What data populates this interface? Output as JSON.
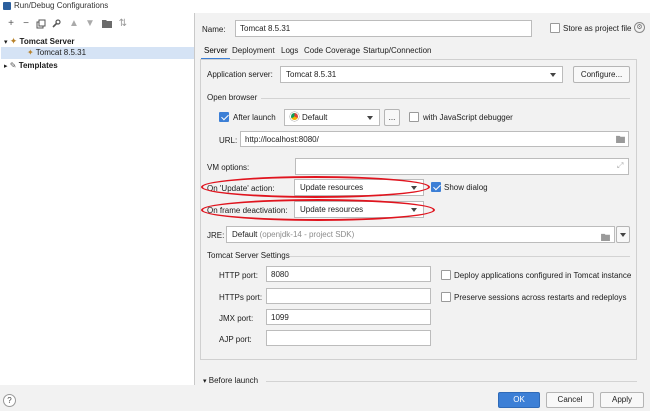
{
  "window": {
    "title": "Run/Debug Configurations"
  },
  "toolbar": {
    "icons": [
      "plus-icon",
      "minus-icon",
      "copy-icon",
      "wrench-icon",
      "arrow-up-icon",
      "arrow-down-icon",
      "folder-icon",
      "sort-icon"
    ]
  },
  "tree": {
    "groups": [
      {
        "label": "Tomcat Server",
        "expanded": true,
        "children": [
          {
            "label": "Tomcat 8.5.31",
            "selected": true
          }
        ]
      },
      {
        "label": "Templates",
        "expanded": false
      }
    ]
  },
  "form": {
    "name_label": "Name:",
    "name_value": "Tomcat 8.5.31",
    "store_as_project_file": "Store as project file",
    "tabs": [
      "Server",
      "Deployment",
      "Logs",
      "Code Coverage",
      "Startup/Connection"
    ],
    "active_tab": "Server",
    "app_server_label": "Application server:",
    "app_server_value": "Tomcat 8.5.31",
    "configure_button": "Configure...",
    "open_browser_title": "Open browser",
    "after_launch_label": "After launch",
    "after_launch_checked": true,
    "browser_value": "Default",
    "ellipsis_button": "...",
    "js_debugger_label": "with JavaScript debugger",
    "js_debugger_checked": false,
    "url_label": "URL:",
    "url_value": "http://localhost:8080/",
    "vm_options_label": "VM options:",
    "vm_options_value": "",
    "on_update_label": "On 'Update' action:",
    "on_update_value": "Update resources",
    "show_dialog_label": "Show dialog",
    "show_dialog_checked": true,
    "on_frame_label": "On frame deactivation:",
    "on_frame_value": "Update resources",
    "jre_label": "JRE:",
    "jre_value": "Default",
    "jre_hint": "(openjdk-14 - project SDK)",
    "server_settings_title": "Tomcat Server Settings",
    "http_port_label": "HTTP port:",
    "http_port_value": "8080",
    "https_port_label": "HTTPs port:",
    "https_port_value": "",
    "jmx_port_label": "JMX port:",
    "jmx_port_value": "1099",
    "ajp_port_label": "AJP port:",
    "ajp_port_value": "",
    "deploy_label": "Deploy applications configured in Tomcat instance",
    "preserve_label": "Preserve sessions across restarts and redeploys",
    "before_launch_label": "Before launch"
  },
  "footer": {
    "help": "?",
    "ok": "OK",
    "cancel": "Cancel",
    "apply": "Apply"
  },
  "colors": {
    "accent": "#3c7fd6",
    "highlight": "#e0141e",
    "selection": "#d5e3f5"
  }
}
